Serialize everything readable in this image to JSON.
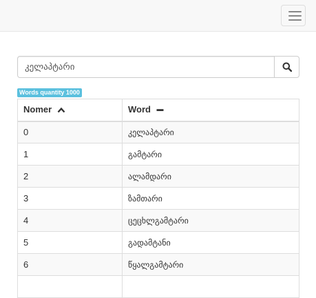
{
  "navbar": {
    "toggle_icon": "hamburger-menu-icon"
  },
  "search": {
    "value": "კელაპტარი",
    "button_icon": "search-icon"
  },
  "badge": {
    "label": "Words quantity 1000",
    "color": "#5bc0de"
  },
  "table": {
    "headers": [
      {
        "label": "Nomer",
        "icon": "sort-ascending-icon"
      },
      {
        "label": "Word",
        "icon": "minus-icon"
      }
    ],
    "rows": [
      {
        "nomer": "0",
        "word": "კელაპტარი"
      },
      {
        "nomer": "1",
        "word": "გამტარი"
      },
      {
        "nomer": "2",
        "word": "ალამდარი"
      },
      {
        "nomer": "3",
        "word": "ზამთარი"
      },
      {
        "nomer": "4",
        "word": "ცეცხლგამტარი"
      },
      {
        "nomer": "5",
        "word": "გადამტანი"
      },
      {
        "nomer": "6",
        "word": "წყალგამტარი"
      },
      {
        "nomer": "",
        "word": ""
      }
    ]
  }
}
